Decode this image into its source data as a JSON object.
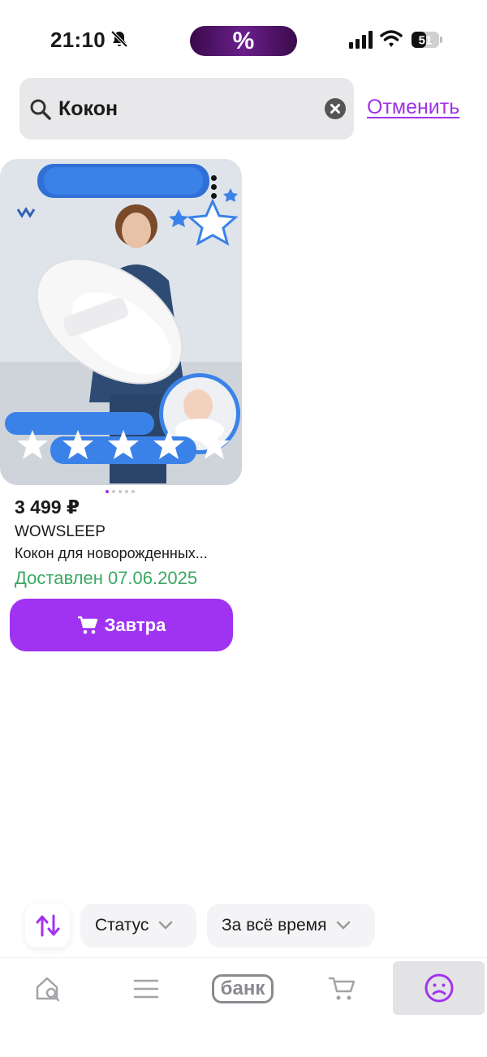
{
  "status_bar": {
    "time": "21:10",
    "promo_symbol": "%",
    "battery_level": "51"
  },
  "search": {
    "query": "Кокон",
    "cancel_label": "Отменить"
  },
  "product": {
    "rating_stars": 5,
    "image_pages": 5,
    "current_image": 1,
    "price": "3 499 ₽",
    "brand": "WOWSLEEP",
    "title": "Кокон для новорожденных...",
    "delivery_status": "Доставлен 07.06.2025",
    "buy_label": "Завтра"
  },
  "filters": {
    "status_label": "Статус",
    "period_label": "За всё время"
  },
  "bottom_nav": {
    "bank_label": "банк",
    "active_tab": "profile"
  },
  "colors": {
    "accent": "#a033f2",
    "delivered_green": "#3aa862"
  }
}
